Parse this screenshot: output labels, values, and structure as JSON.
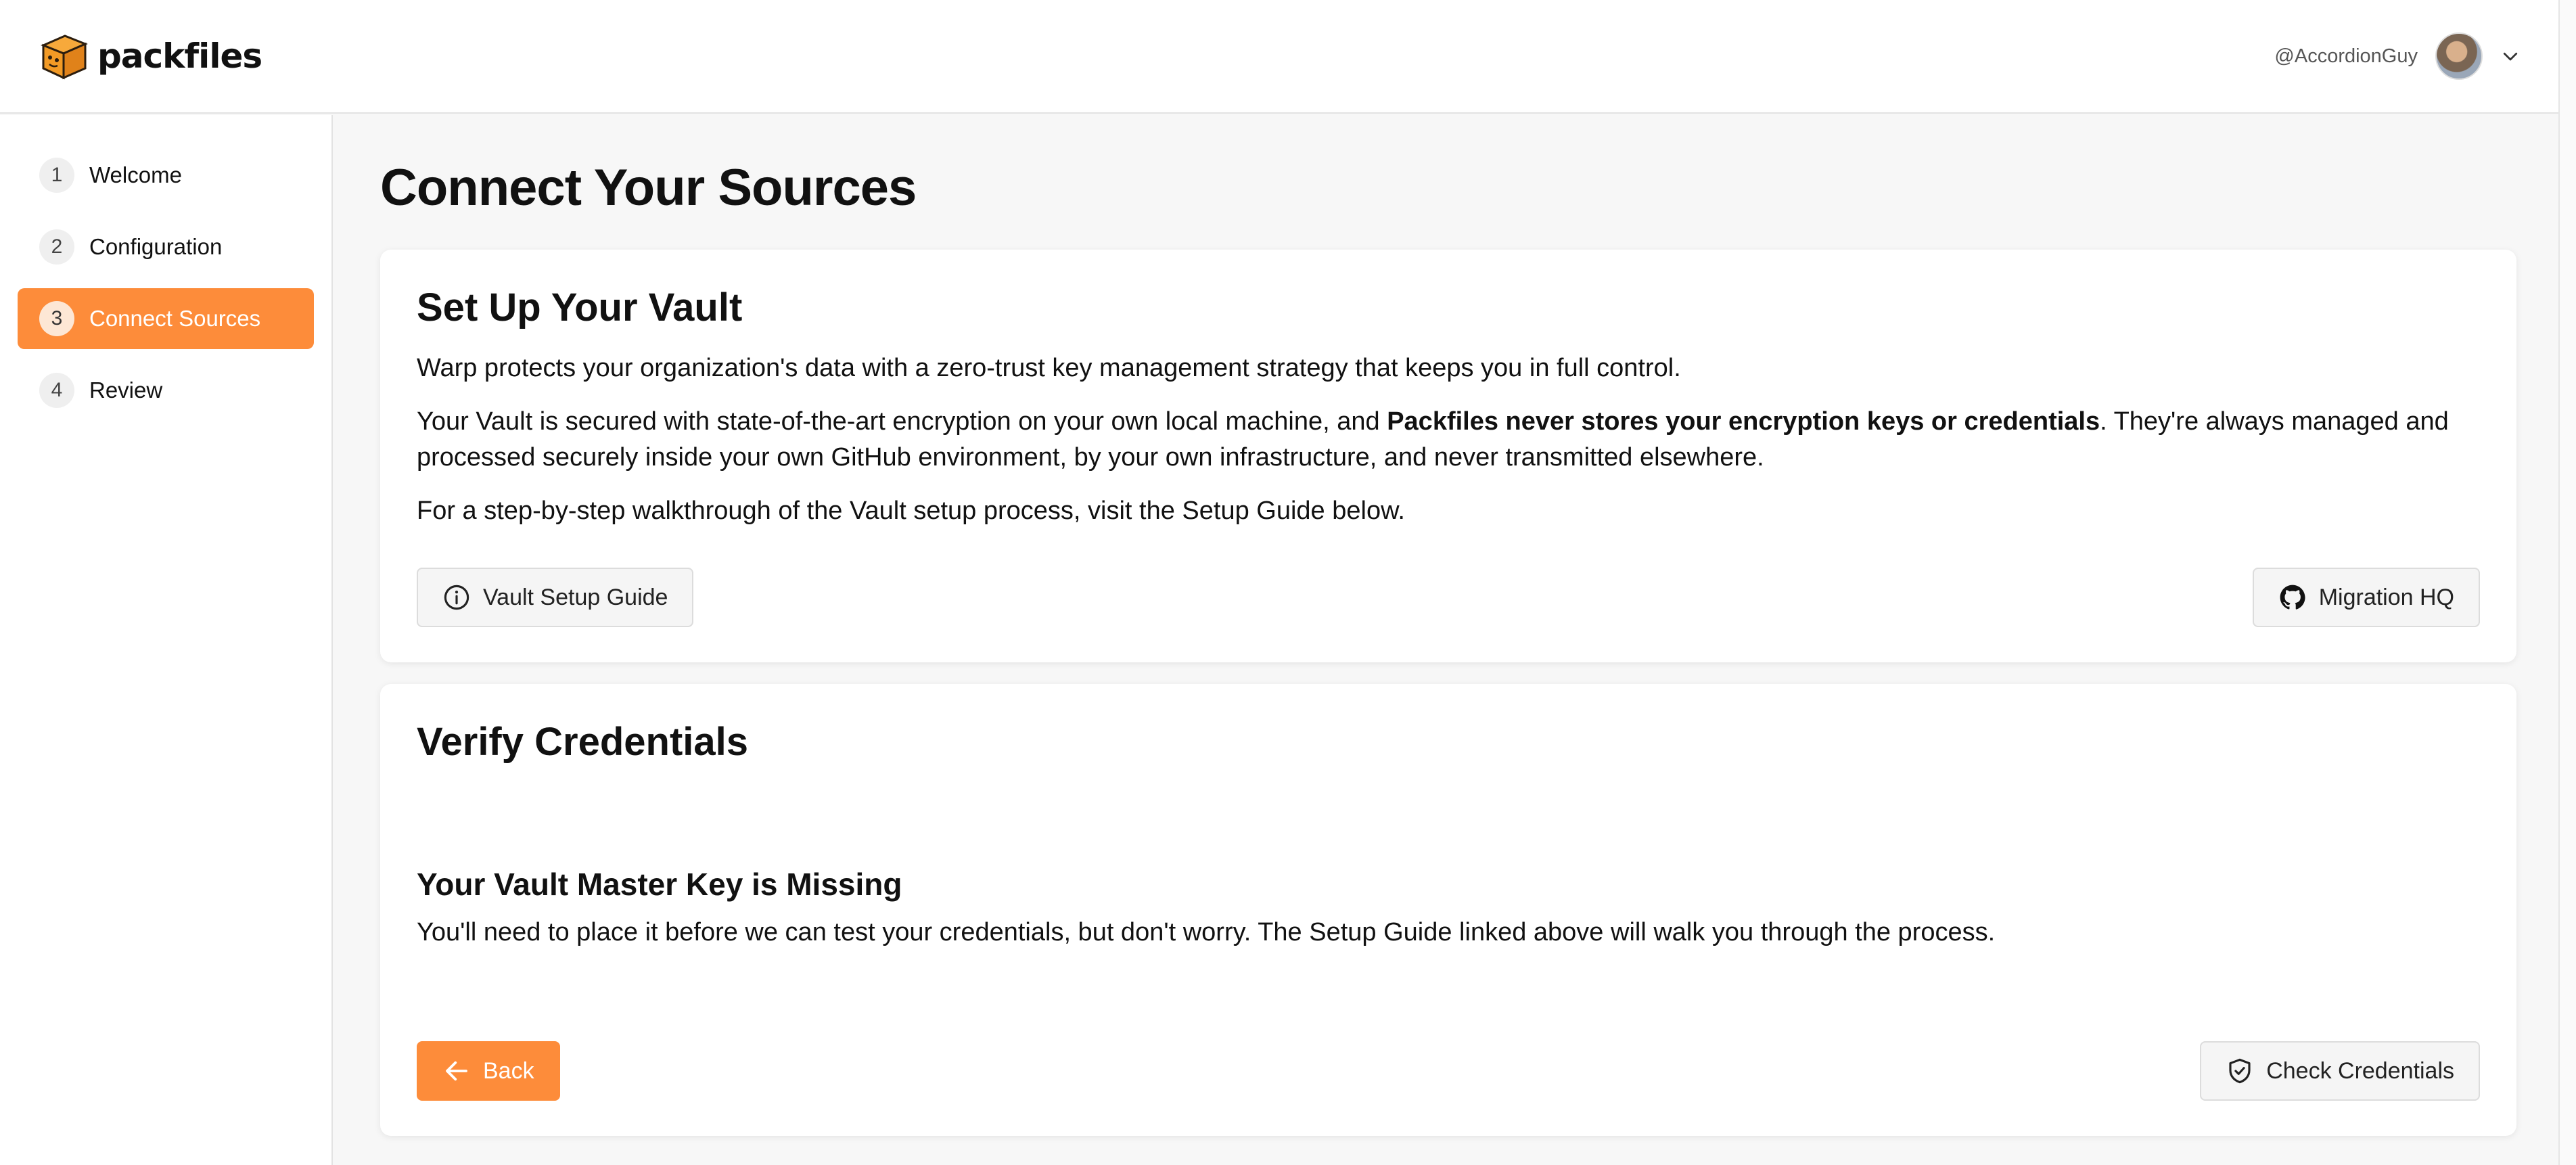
{
  "app": {
    "logo_text": "packfiles",
    "username": "@AccordionGuy"
  },
  "sidebar": {
    "steps": [
      {
        "num": "1",
        "label": "Welcome"
      },
      {
        "num": "2",
        "label": "Configuration"
      },
      {
        "num": "3",
        "label": "Connect Sources",
        "active": true
      },
      {
        "num": "4",
        "label": "Review"
      }
    ]
  },
  "main": {
    "title": "Connect Your Sources",
    "vault": {
      "heading": "Set Up Your Vault",
      "para1": "Warp protects your organization's data with a zero-trust key management strategy that keeps you in full control.",
      "para2_before": "Your Vault is secured with state-of-the-art encryption on your own local machine, and ",
      "para2_bold": "Packfiles never stores your encryption keys or credentials",
      "para2_after": ". They're always managed and processed securely inside your own GitHub environment, by your own infrastructure, and never transmitted elsewhere.",
      "para3": "For a step-by-step walkthrough of the Vault setup process, visit the Setup Guide below.",
      "guide_button": "Vault Setup Guide",
      "hq_button": "Migration HQ"
    },
    "verify": {
      "heading": "Verify Credentials",
      "missing_title": "Your Vault Master Key is Missing",
      "missing_text": "You'll need to place it before we can test your credentials, but don't worry. The Setup Guide linked above will walk you through the process.",
      "back_button": "Back",
      "check_button": "Check Credentials"
    }
  },
  "colors": {
    "accent": "#fd8c3a",
    "background": "#f7f7f7"
  }
}
